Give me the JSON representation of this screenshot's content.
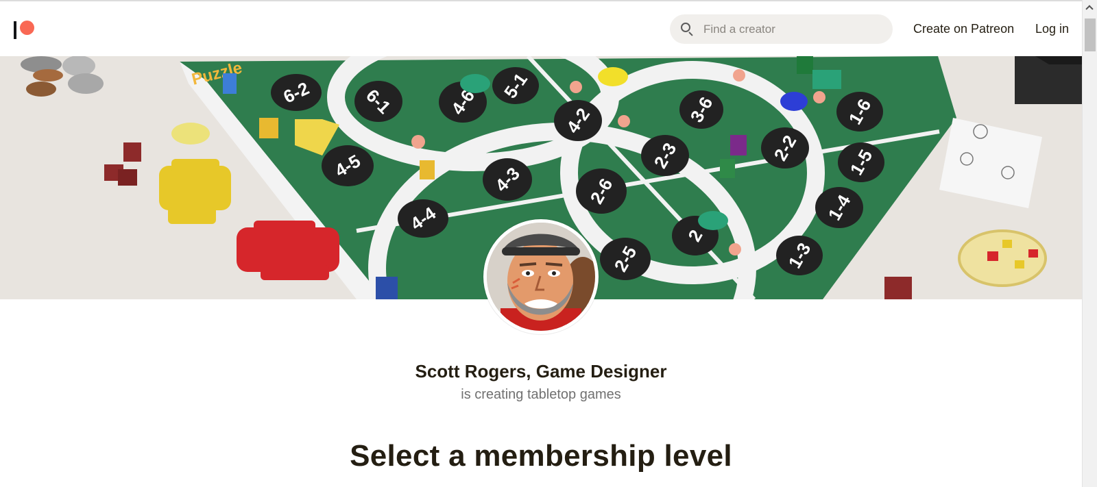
{
  "header": {
    "logo_name": "patreon-logo",
    "search_placeholder": "Find a creator",
    "create_label": "Create on Patreon",
    "login_label": "Log in"
  },
  "banner": {
    "space_labels": [
      "6-2",
      "6-1",
      "4-6",
      "5-1",
      "4-5",
      "4-2",
      "4-3",
      "2-3",
      "3-6",
      "2-2",
      "1-6",
      "1-5",
      "2-6",
      "4-4",
      "1-4",
      "2-5",
      "1-3",
      "2"
    ],
    "title_fragment": "Puzzle"
  },
  "creator": {
    "name": "Scott Rogers, Game Designer",
    "tagline": "is creating tabletop games"
  },
  "main": {
    "section_title": "Select a membership level"
  },
  "colors": {
    "brand": "#f96854",
    "text": "#241e12",
    "board_green": "#2e7d4f"
  }
}
